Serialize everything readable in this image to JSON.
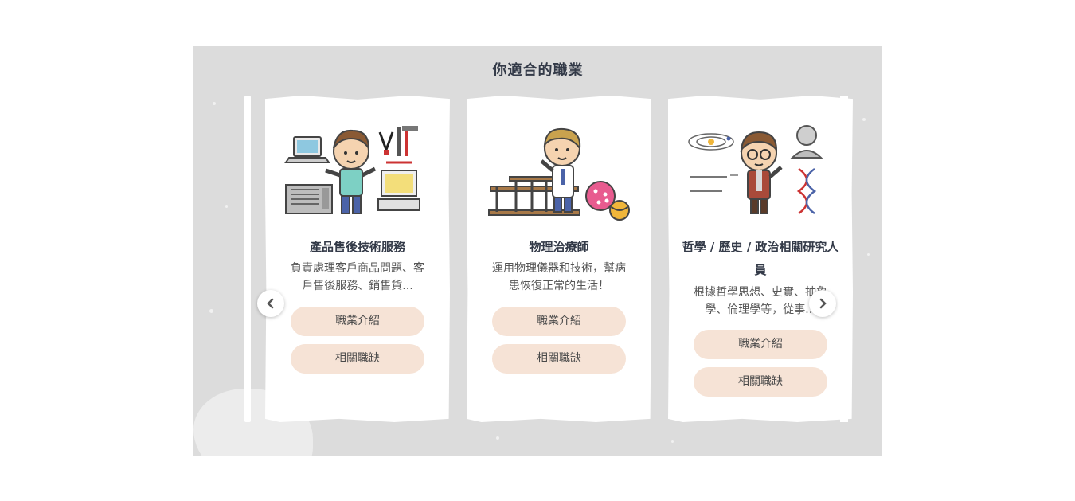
{
  "section": {
    "title": "你適合的職業"
  },
  "cards": [
    {
      "title": "產品售後技術服務",
      "description": "負責處理客戶商品問題、客戶售後服務、銷售貨...",
      "buttons": {
        "intro": "職業介紹",
        "jobs": "相關職缺"
      },
      "illustration": "technician-with-computers-and-tools"
    },
    {
      "title": "物理治療師",
      "description": "運用物理儀器和技術，幫病患恢復正常的生活！",
      "buttons": {
        "intro": "職業介紹",
        "jobs": "相關職缺"
      },
      "illustration": "therapist-with-parallel-bars-and-balls"
    },
    {
      "title": "哲學 / 歷史 / 政治相關研究人員",
      "description": "根據哲學思想、史實、抽象學、倫理學等，從事...",
      "buttons": {
        "intro": "職業介紹",
        "jobs": "相關職缺"
      },
      "illustration": "researcher-with-formulas-and-dna"
    }
  ],
  "navigation": {
    "prev_icon": "chevron-left-icon",
    "next_icon": "chevron-right-icon"
  },
  "colors": {
    "panel": "#dcdcdc",
    "button": "#f6e3d6",
    "title": "#333a48"
  }
}
